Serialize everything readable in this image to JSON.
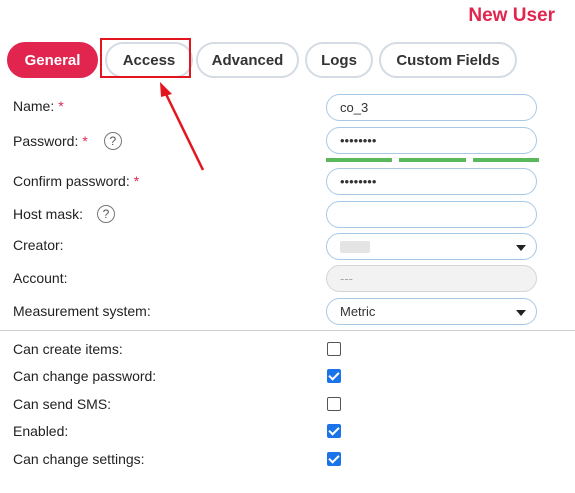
{
  "header": {
    "title": "New User"
  },
  "tabs": [
    {
      "label": "General",
      "active": true
    },
    {
      "label": "Access",
      "active": false
    },
    {
      "label": "Advanced",
      "active": false
    },
    {
      "label": "Logs",
      "active": false
    },
    {
      "label": "Custom Fields",
      "active": false
    }
  ],
  "form": {
    "name": {
      "label": "Name:",
      "required_mark": "*",
      "value": "co_3"
    },
    "password": {
      "label": "Password:",
      "required_mark": "*",
      "help": "?",
      "value": "••••••••"
    },
    "confirm_password": {
      "label": "Confirm password:",
      "required_mark": "*",
      "value": "••••••••"
    },
    "host_mask": {
      "label": "Host mask:",
      "help": "?",
      "value": ""
    },
    "creator": {
      "label": "Creator:"
    },
    "account": {
      "label": "Account:",
      "value": "---"
    },
    "measurement_system": {
      "label": "Measurement system:",
      "value": "Metric"
    }
  },
  "password_strength": {
    "segments_filled": 3,
    "segments_total": 3,
    "color": "#5cb85c"
  },
  "permissions": [
    {
      "label": "Can create items:",
      "checked": false
    },
    {
      "label": "Can change password:",
      "checked": true
    },
    {
      "label": "Can send SMS:",
      "checked": false
    },
    {
      "label": "Enabled:",
      "checked": true
    },
    {
      "label": "Can change settings:",
      "checked": true
    }
  ],
  "colors": {
    "accent": "#e2254f",
    "annotation": "#e3151f",
    "checkbox": "#1a73e8"
  }
}
